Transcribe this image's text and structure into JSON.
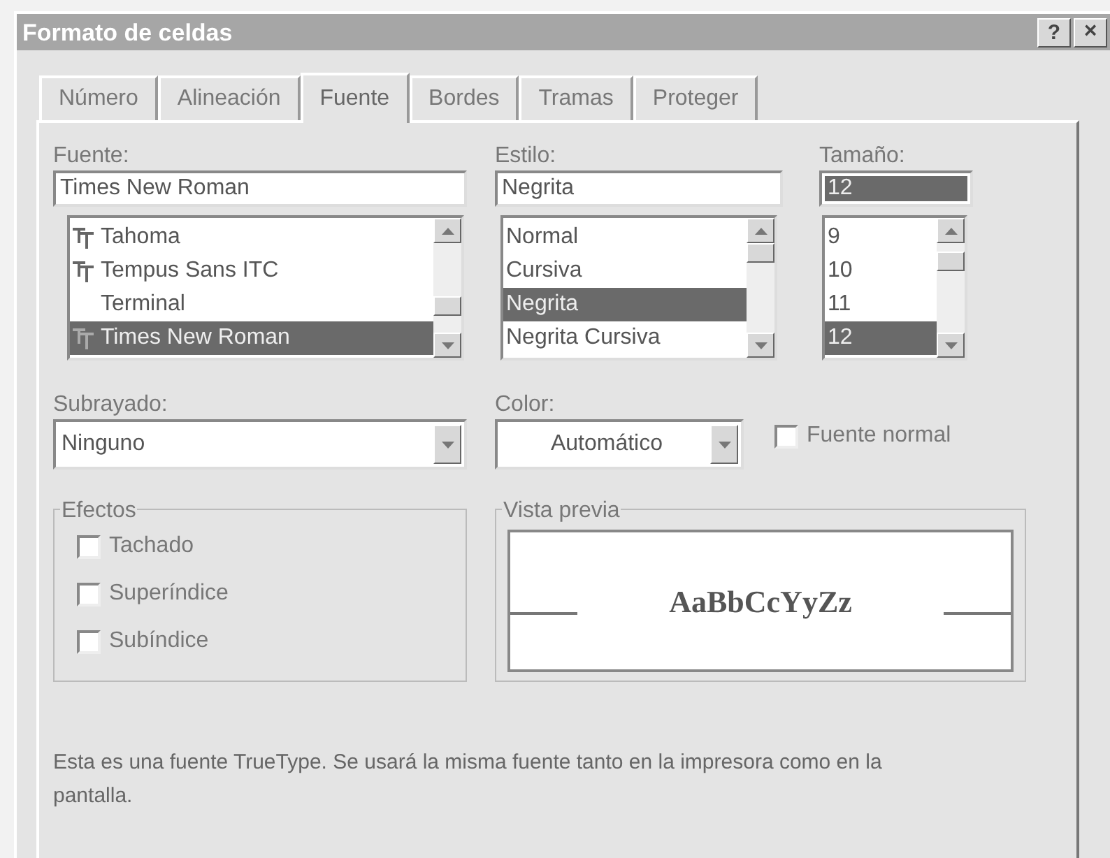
{
  "window": {
    "title": "Formato de celdas",
    "help_button": "?",
    "close_button": "×"
  },
  "tabs": [
    {
      "label": "Número",
      "selected": false
    },
    {
      "label": "Alineación",
      "selected": false
    },
    {
      "label": "Fuente",
      "selected": true
    },
    {
      "label": "Bordes",
      "selected": false
    },
    {
      "label": "Tramas",
      "selected": false
    },
    {
      "label": "Proteger",
      "selected": false
    }
  ],
  "font": {
    "label": "Fuente:",
    "value": "Times New Roman",
    "items": [
      {
        "text": "Tahoma",
        "kind": "truetype",
        "selected": false
      },
      {
        "text": "Tempus Sans ITC",
        "kind": "truetype",
        "selected": false
      },
      {
        "text": "Terminal",
        "kind": "plain",
        "selected": false
      },
      {
        "text": "Times New Roman",
        "kind": "truetype",
        "selected": true
      }
    ]
  },
  "style": {
    "label": "Estilo:",
    "value": "Negrita",
    "items": [
      {
        "text": "Normal",
        "selected": false
      },
      {
        "text": "Cursiva",
        "selected": false
      },
      {
        "text": "Negrita",
        "selected": true
      },
      {
        "text": "Negrita Cursiva",
        "selected": false
      }
    ]
  },
  "size": {
    "label": "Tamaño:",
    "value": "12",
    "items": [
      {
        "text": "9",
        "selected": false
      },
      {
        "text": "10",
        "selected": false
      },
      {
        "text": "11",
        "selected": false
      },
      {
        "text": "12",
        "selected": true
      }
    ]
  },
  "underline": {
    "label": "Subrayado:",
    "value": "Ninguno"
  },
  "color": {
    "label": "Color:",
    "value": "Automático"
  },
  "normal_font": {
    "label": "Fuente normal",
    "checked": false
  },
  "effects": {
    "title": "Efectos",
    "items": [
      {
        "label": "Tachado",
        "checked": false
      },
      {
        "label": "Superíndice",
        "checked": false
      },
      {
        "label": "Subíndice",
        "checked": false
      }
    ]
  },
  "preview": {
    "title": "Vista previa",
    "sample": "AaBbCcYyZz"
  },
  "info": "Esta es una fuente TrueType. Se usará la misma fuente tanto en la impresora como en la pantalla."
}
